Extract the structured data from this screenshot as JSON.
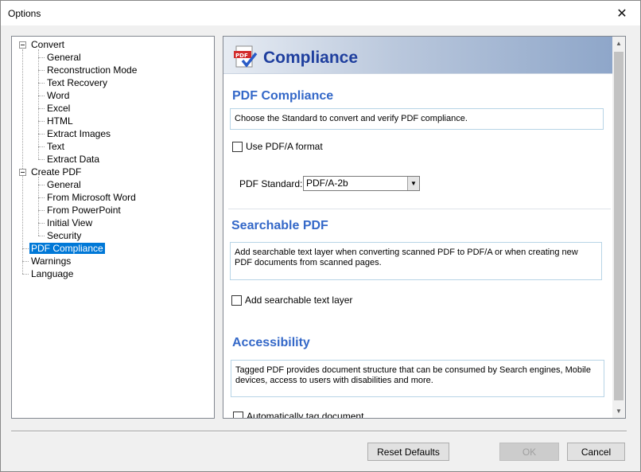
{
  "window": {
    "title": "Options"
  },
  "tree": {
    "items": [
      {
        "label": "Convert",
        "level": 0
      },
      {
        "label": "General",
        "level": 1
      },
      {
        "label": "Reconstruction Mode",
        "level": 1
      },
      {
        "label": "Text Recovery",
        "level": 1
      },
      {
        "label": "Word",
        "level": 1
      },
      {
        "label": "Excel",
        "level": 1
      },
      {
        "label": "HTML",
        "level": 1
      },
      {
        "label": "Extract Images",
        "level": 1
      },
      {
        "label": "Text",
        "level": 1
      },
      {
        "label": "Extract Data",
        "level": 1
      },
      {
        "label": "Create PDF",
        "level": 0
      },
      {
        "label": "General",
        "level": 1
      },
      {
        "label": "From Microsoft Word",
        "level": 1
      },
      {
        "label": "From PowerPoint",
        "level": 1
      },
      {
        "label": "Initial View",
        "level": 1
      },
      {
        "label": "Security",
        "level": 1
      },
      {
        "label": "PDF Compliance",
        "level": 0,
        "selected": true
      },
      {
        "label": "Warnings",
        "level": 0
      },
      {
        "label": "Language",
        "level": 0
      }
    ]
  },
  "banner": {
    "title": "Compliance"
  },
  "sections": {
    "pdf_compliance": {
      "title": "PDF Compliance",
      "description": "Choose the Standard to convert and verify PDF compliance.",
      "checkbox_label": "Use PDF/A format",
      "standard_label": "PDF Standard:",
      "standard_value": "PDF/A-2b"
    },
    "searchable": {
      "title": "Searchable PDF",
      "description": "Add searchable text layer when converting scanned PDF to PDF/A or when creating new PDF documents from scanned pages.",
      "checkbox_label": "Add searchable text layer"
    },
    "accessibility": {
      "title": "Accessibility",
      "description": "Tagged PDF provides document structure that can be consumed by Search engines, Mobile devices, access to users with disabilities and more.",
      "checkbox_label": "Automatically tag document"
    }
  },
  "buttons": {
    "reset": "Reset Defaults",
    "ok": "OK",
    "cancel": "Cancel"
  }
}
